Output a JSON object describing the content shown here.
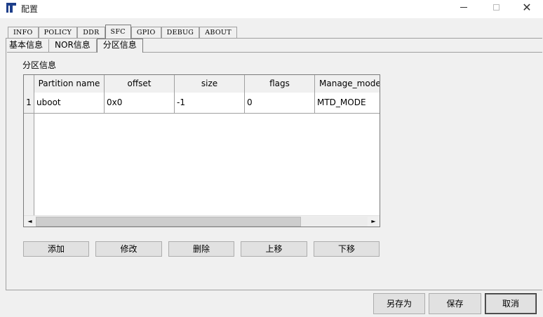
{
  "window": {
    "title": "配置",
    "controls": {
      "minimize": "—",
      "maximize": "☐",
      "close": "✕"
    }
  },
  "tabs": [
    {
      "label": "INFO",
      "active": false
    },
    {
      "label": "POLICY",
      "active": false
    },
    {
      "label": "DDR",
      "active": false
    },
    {
      "label": "SFC",
      "active": true
    },
    {
      "label": "GPIO",
      "active": false
    },
    {
      "label": "DEBUG",
      "active": false
    },
    {
      "label": "ABOUT",
      "active": false
    }
  ],
  "subtabs": [
    {
      "label": "基本信息",
      "active": false
    },
    {
      "label": "NOR信息",
      "active": false
    },
    {
      "label": "分区信息",
      "active": true
    }
  ],
  "partition": {
    "group_label": "分区信息",
    "columns": [
      "Partition name",
      "offset",
      "size",
      "flags",
      "Manage_mode"
    ],
    "rows": [
      {
        "index": "1",
        "cells": [
          "uboot",
          "0x0",
          "-1",
          "0",
          "MTD_MODE"
        ]
      }
    ],
    "scroll": {
      "left_arrow": "◄",
      "right_arrow": "►"
    },
    "buttons": {
      "add": "添加",
      "modify": "修改",
      "delete": "删除",
      "up": "上移",
      "down": "下移"
    }
  },
  "footer": {
    "save_as": "另存为",
    "save": "保存",
    "cancel": "取消"
  },
  "colors": {
    "background": "#f0f0f0",
    "grid_background": "#ffffff",
    "app_icon": "#1e3f8a"
  }
}
